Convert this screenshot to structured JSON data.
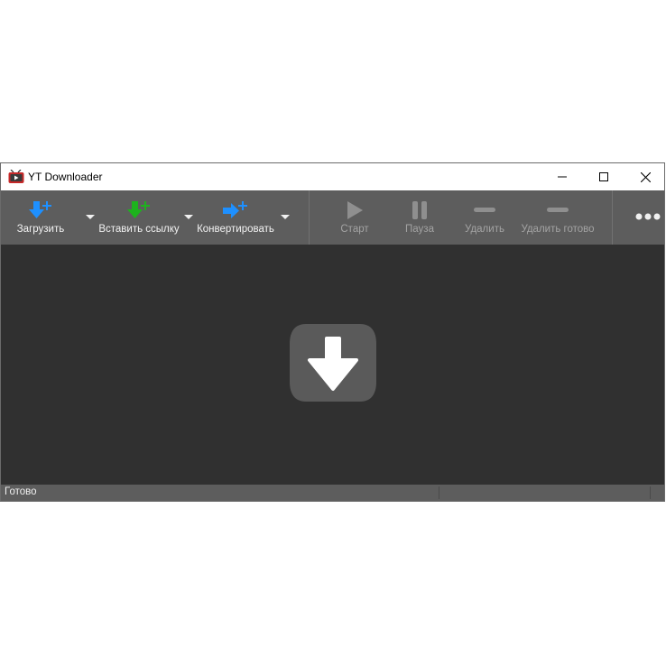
{
  "window": {
    "title": "YT Downloader"
  },
  "toolbar": {
    "download_label": "Загрузить",
    "paste_link_label": "Вставить ссылку",
    "convert_label": "Конвертировать",
    "start_label": "Старт",
    "pause_label": "Пауза",
    "delete_label": "Удалить",
    "delete_done_label": "Удалить готово"
  },
  "status": {
    "text": "Готово"
  },
  "colors": {
    "accent_blue": "#1e90ff",
    "accent_green": "#1db31d",
    "toolbar_bg": "#5d5d5d",
    "content_bg": "#303030"
  }
}
